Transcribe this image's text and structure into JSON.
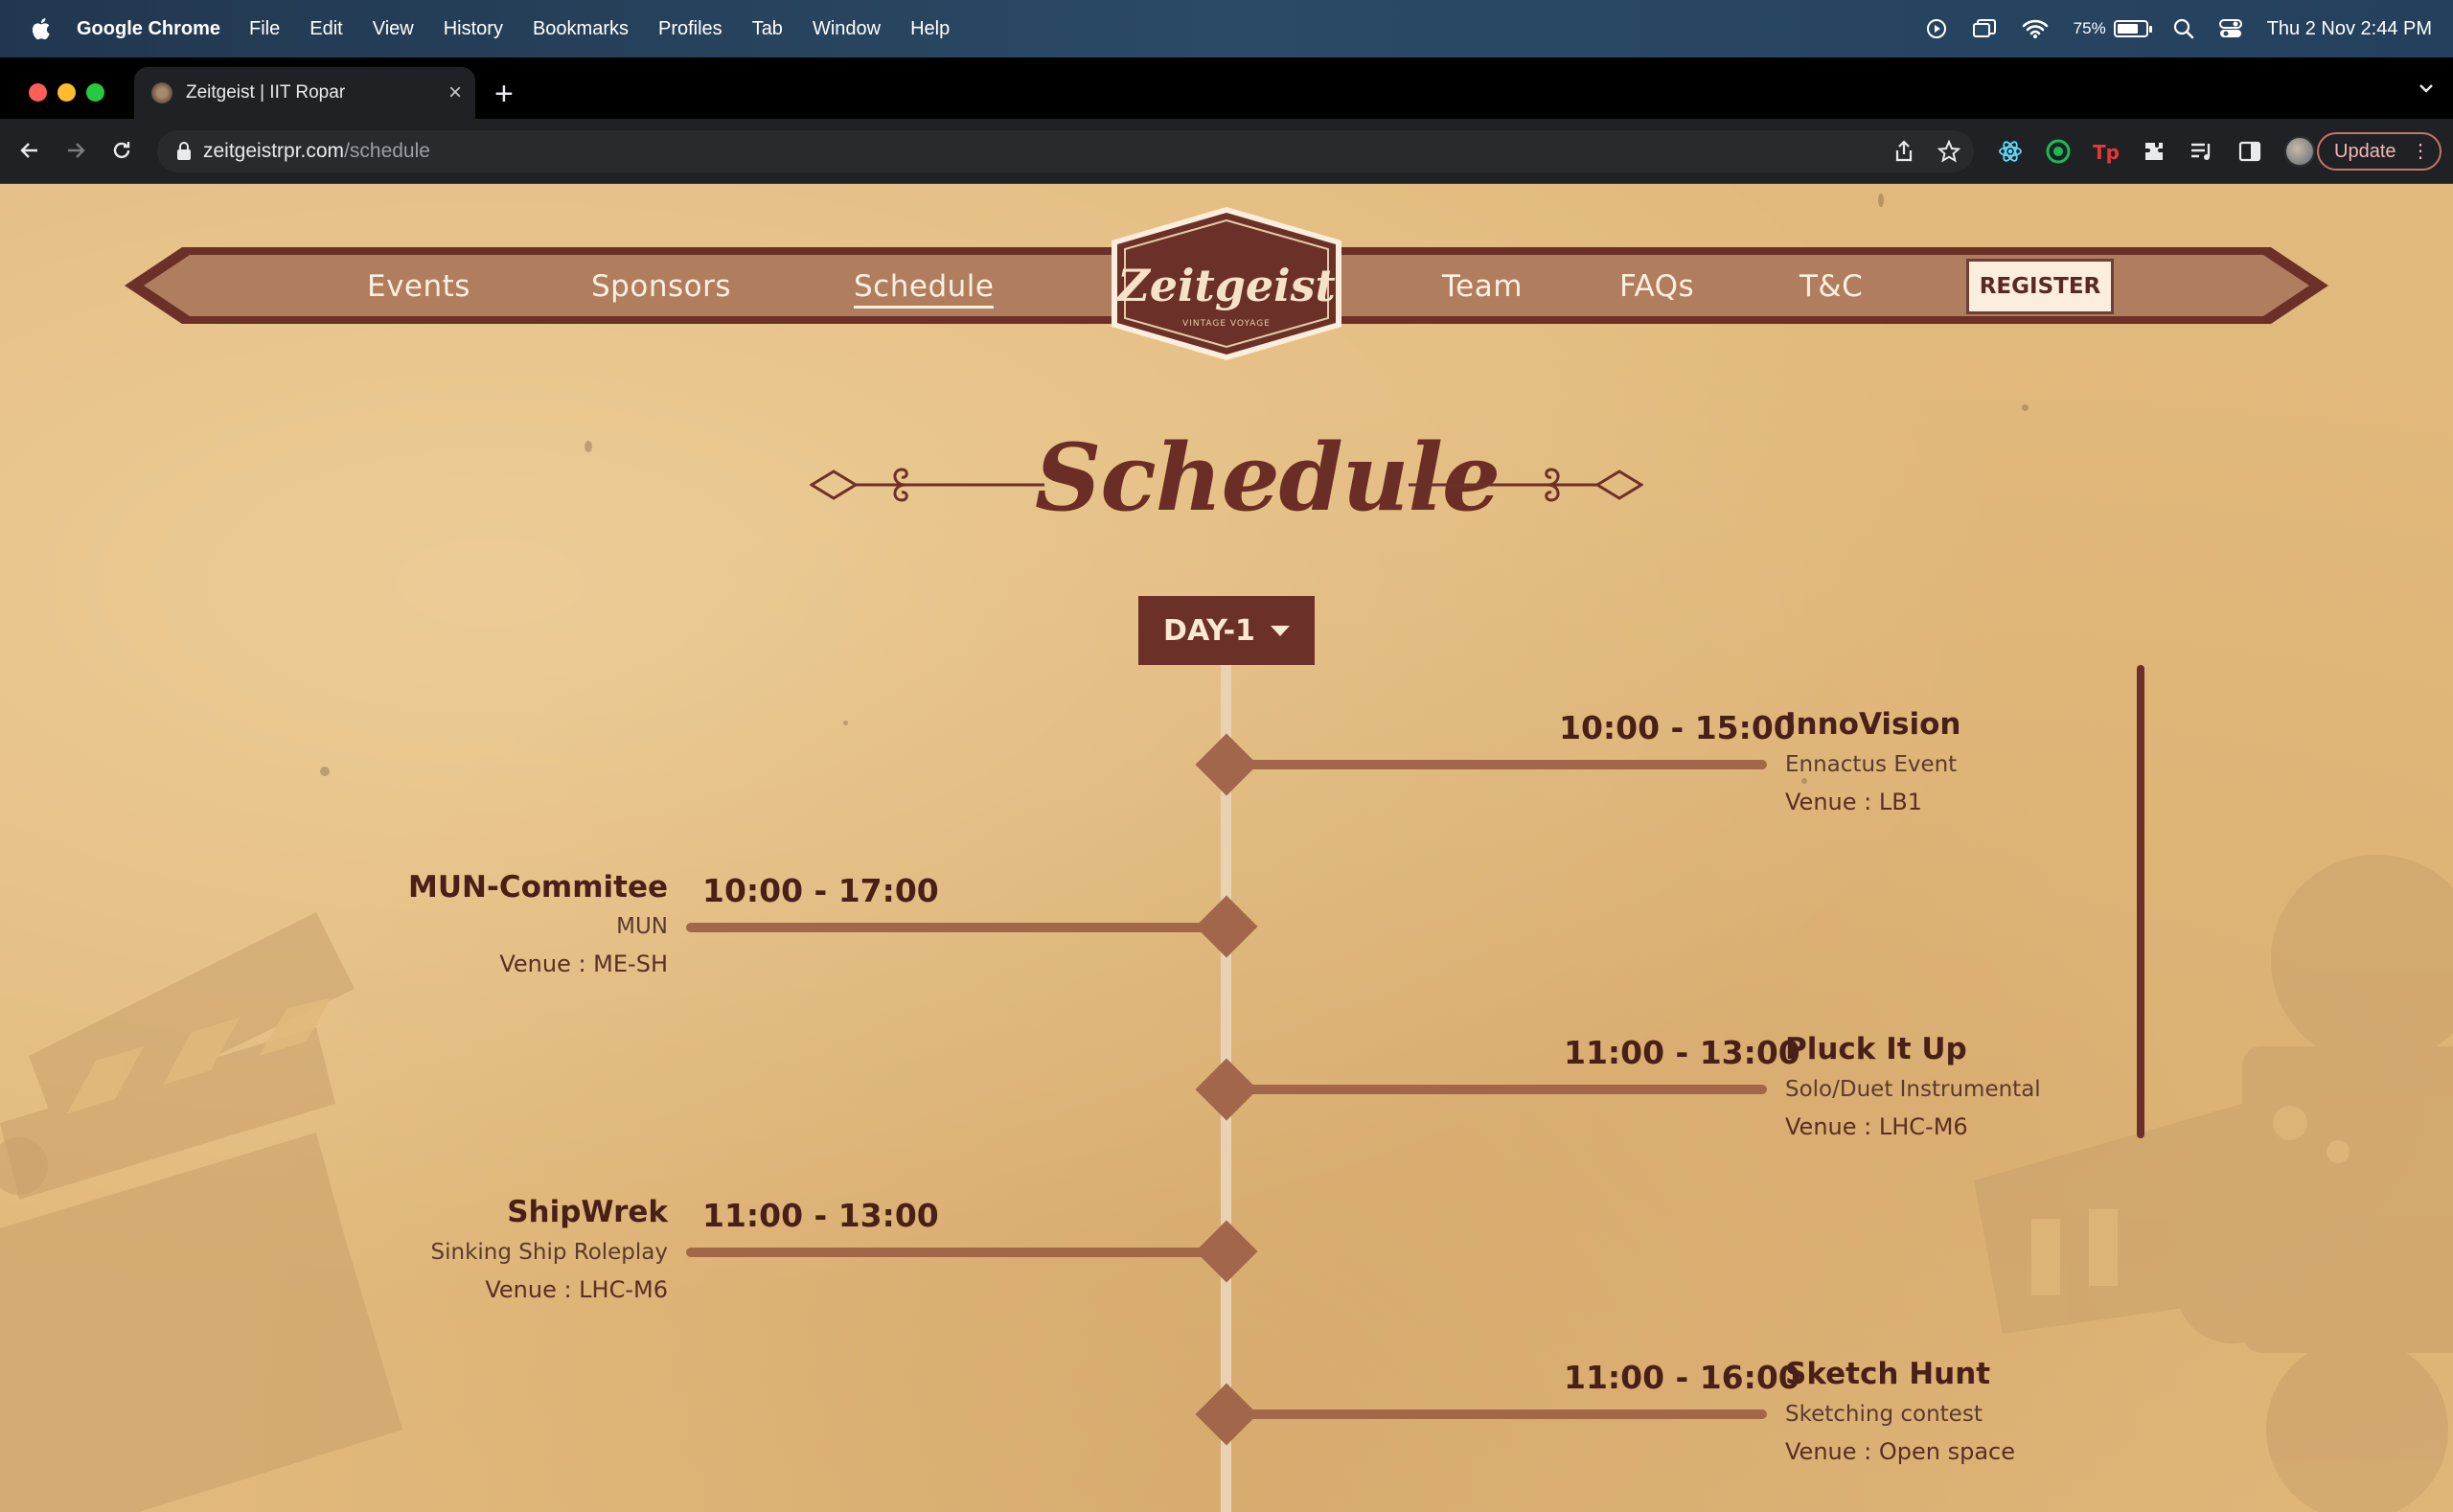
{
  "menubar": {
    "app_name": "Google Chrome",
    "items": [
      "File",
      "Edit",
      "View",
      "History",
      "Bookmarks",
      "Profiles",
      "Tab",
      "Window",
      "Help"
    ],
    "battery_percent": "75%",
    "battery_level": 0.75,
    "datetime": "Thu 2 Nov  2:44 PM"
  },
  "browser": {
    "tab_title": "Zeitgeist | IIT Ropar",
    "url_host": "zeitgeistrpr.com",
    "url_path": "/schedule",
    "update_label": "Update"
  },
  "nav": {
    "links_left": [
      "Events",
      "Sponsors",
      "Schedule"
    ],
    "links_right": [
      "Team",
      "FAQs",
      "T&C"
    ],
    "active": "Schedule",
    "register_label": "REGISTER",
    "logo_text": "Zeitgeist",
    "logo_tagline": "VINTAGE VOYAGE"
  },
  "page": {
    "title": "Schedule",
    "day_selected": "DAY-1"
  },
  "events": [
    {
      "side": "right",
      "time": "10:00 - 15:00",
      "name": "InnoVision",
      "category": "Ennactus Event",
      "venue": "Venue : LB1"
    },
    {
      "side": "left",
      "time": "10:00 - 17:00",
      "name": "MUN-Commitee",
      "category": "MUN",
      "venue": "Venue : ME-SH"
    },
    {
      "side": "right",
      "time": "11:00 - 13:00",
      "name": "Pluck It Up",
      "category": "Solo/Duet Instrumental",
      "venue": "Venue : LHC-M6"
    },
    {
      "side": "left",
      "time": "11:00 - 13:00",
      "name": "ShipWrek",
      "category": "Sinking Ship Roleplay",
      "venue": "Venue : LHC-M6"
    },
    {
      "side": "right",
      "time": "11:00 - 16:00",
      "name": "Sketch Hunt",
      "category": "Sketching contest",
      "venue": "Venue : Open space"
    }
  ],
  "colors": {
    "background": "#e2b97c",
    "banner": "#b07d5e",
    "accent_dark": "#6b3128",
    "timeline": "#a2674a"
  },
  "icons": [
    "apple-icon",
    "play-icon",
    "screen-mirror-icon",
    "wifi-icon",
    "battery-icon",
    "spotlight-icon",
    "control-center-icon",
    "back-icon",
    "forward-icon",
    "reload-icon",
    "lock-icon",
    "share-icon",
    "star-icon",
    "extensions-icon",
    "reading-list-icon",
    "sidebar-icon"
  ]
}
